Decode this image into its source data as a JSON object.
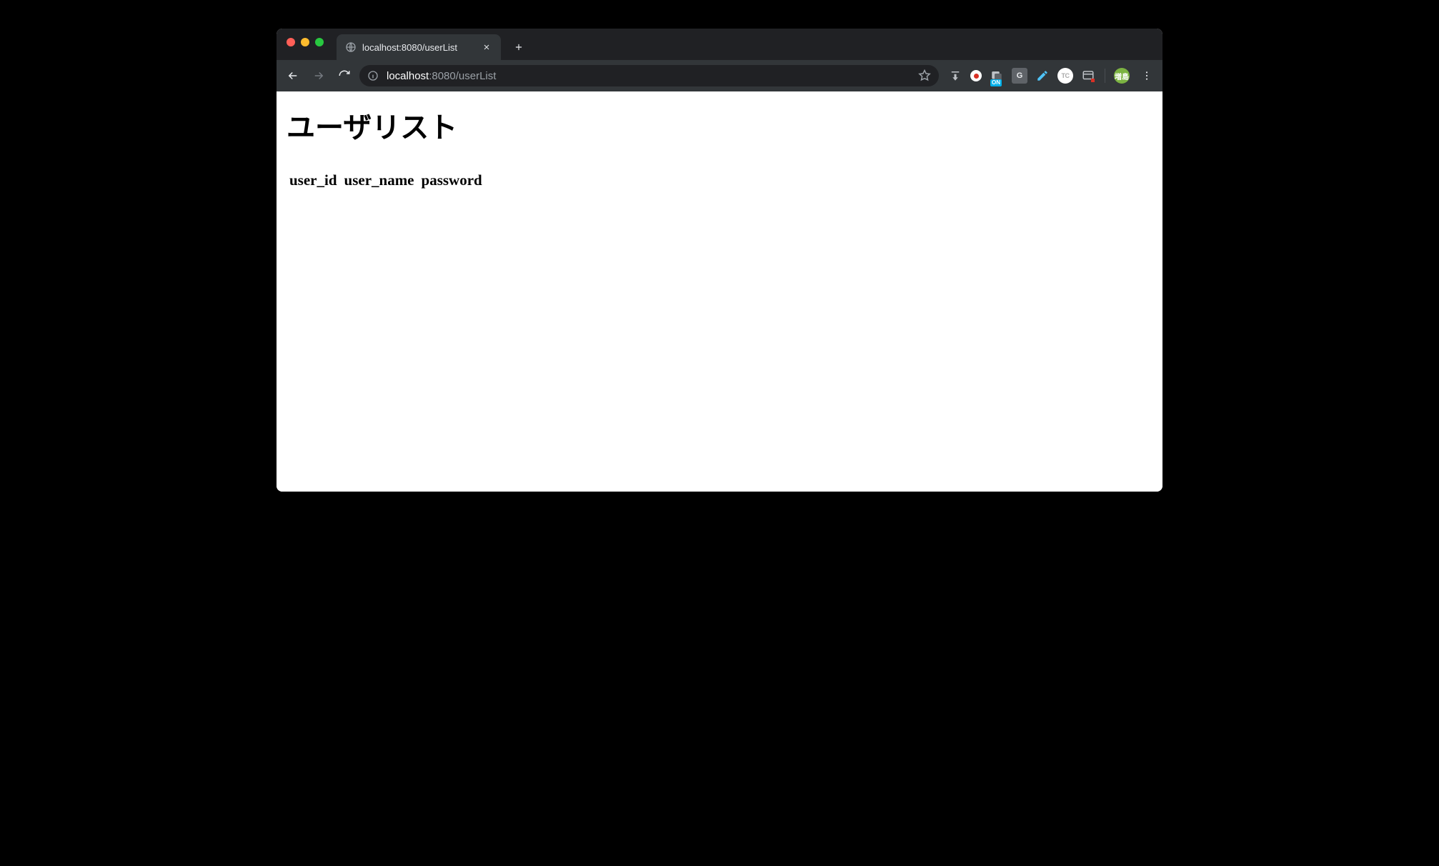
{
  "tab": {
    "title": "localhost:8080/userList"
  },
  "url": {
    "host": "localhost",
    "port_path": ":8080/userList"
  },
  "extensions": {
    "translate_badge": "ON",
    "g_label": "G",
    "tc_label": "TC"
  },
  "profile": {
    "avatar_label": "増島"
  },
  "page": {
    "heading": "ユーザリスト",
    "table_headers": [
      "user_id",
      "user_name",
      "password"
    ]
  }
}
